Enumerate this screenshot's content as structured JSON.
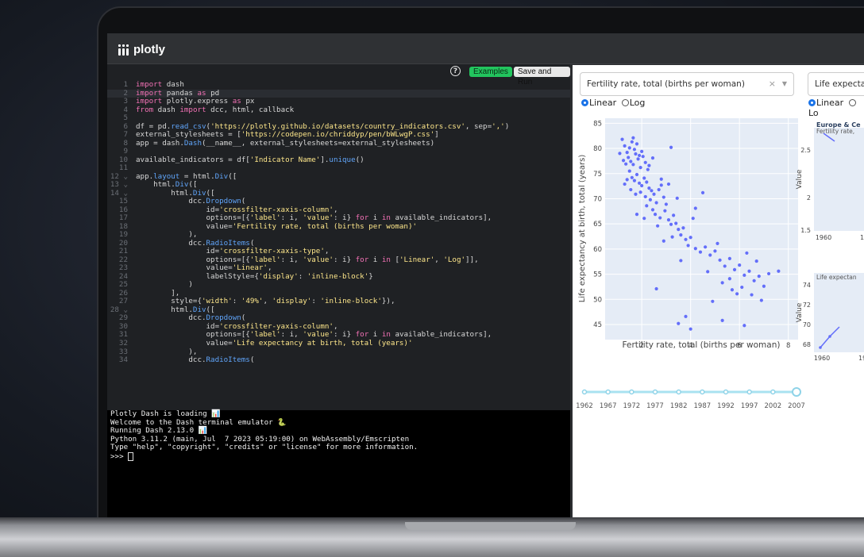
{
  "app": {
    "title": "plotly"
  },
  "toolbar": {
    "help": "?",
    "examples": "Examples",
    "save_run": "Save and Run"
  },
  "code_lines": [
    "import dash",
    "import pandas as pd",
    "import plotly.express as px",
    "from dash import dcc, html, callback",
    "",
    "df = pd.read_csv('https://plotly.github.io/datasets/country_indicators.csv', sep=',')",
    "external_stylesheets = ['https://codepen.io/chriddyp/pen/bWLwgP.css']",
    "app = dash.Dash(__name__, external_stylesheets=external_stylesheets)",
    "",
    "available_indicators = df['Indicator Name'].unique()",
    "",
    "app.layout = html.Div([",
    "    html.Div([",
    "        html.Div([",
    "            dcc.Dropdown(",
    "                id='crossfilter-xaxis-column',",
    "                options=[{'label': i, 'value': i} for i in available_indicators],",
    "                value='Fertility rate, total (births per woman)'",
    "            ),",
    "            dcc.RadioItems(",
    "                id='crossfilter-xaxis-type',",
    "                options=[{'label': i, 'value': i} for i in ['Linear', 'Log']],",
    "                value='Linear',",
    "                labelStyle={'display': 'inline-block'}",
    "            )",
    "        ],",
    "        style={'width': '49%', 'display': 'inline-block'}),",
    "        html.Div([",
    "            dcc.Dropdown(",
    "                id='crossfilter-yaxis-column',",
    "                options=[{'label': i, 'value': i} for i in available_indicators],",
    "                value='Life expectancy at birth, total (years)'",
    "            ),",
    "            dcc.RadioItems("
  ],
  "code_line_count": 34,
  "terminal_lines": [
    "Plotly Dash is loading 📊",
    "Welcome to the Dash terminal emulator 🐍",
    "Running Dash 2.13.0 📊",
    "Python 3.11.2 (main, Jul  7 2023 05:19:00) on WebAssembly/Emscripten",
    "Type \"help\", \"copyright\", \"credits\" or \"license\" for more information.",
    ">>> "
  ],
  "dash_app": {
    "x_dropdown": {
      "value": "Fertility rate, total (births per woman)",
      "clear": "×",
      "caret": "▼"
    },
    "y_dropdown": {
      "value": "Life expectanc"
    },
    "x_radio": {
      "linear": "Linear",
      "log": "Log",
      "selected": "Linear"
    },
    "y_radio": {
      "linear": "Linear",
      "log": "Lo",
      "selected": "Linear"
    },
    "slider": {
      "marks": [
        "1962",
        "1967",
        "1972",
        "1977",
        "1982",
        "1987",
        "1992",
        "1997",
        "2002",
        "2007"
      ],
      "selected": "2007"
    },
    "side1": {
      "title": "Europe & Ce",
      "subtitle": "Fertility rate,",
      "ylabel": "Value",
      "yticks": [
        "2.5",
        "2",
        "1.5"
      ],
      "xticks": [
        "1960",
        "19"
      ]
    },
    "side2": {
      "subtitle": "Life expectan",
      "ylabel": "Value",
      "yticks": [
        "74",
        "72",
        "70",
        "68"
      ],
      "xticks": [
        "1960",
        "19"
      ]
    }
  },
  "colors": {
    "marker": "#636efa",
    "plot_bg": "#e5ecf6",
    "accent": "#1a73e8",
    "examples_btn": "#22c55e"
  },
  "chart_data": {
    "type": "scatter",
    "xlabel": "Fertility rate, total (births per woman)",
    "ylabel": "Life expectancy at birth, total (years)",
    "xlim": [
      0.5,
      8.4
    ],
    "ylim": [
      42,
      86
    ],
    "xticks": [
      2,
      4,
      6,
      8
    ],
    "yticks": [
      45,
      50,
      55,
      60,
      65,
      70,
      75,
      80,
      85
    ],
    "grid": true,
    "series": [
      {
        "points": [
          [
            1.3,
            80.5
          ],
          [
            1.4,
            79.2
          ],
          [
            1.5,
            80.1
          ],
          [
            1.6,
            81.3
          ],
          [
            1.7,
            79.8
          ],
          [
            1.8,
            80.9
          ],
          [
            1.9,
            78.6
          ],
          [
            2.0,
            79.4
          ],
          [
            1.2,
            81.8
          ],
          [
            1.1,
            79.0
          ],
          [
            1.45,
            78.2
          ],
          [
            1.55,
            77.4
          ],
          [
            1.65,
            76.8
          ],
          [
            1.75,
            78.9
          ],
          [
            1.85,
            77.9
          ],
          [
            1.95,
            76.2
          ],
          [
            2.05,
            78.4
          ],
          [
            2.15,
            77.2
          ],
          [
            2.25,
            75.8
          ],
          [
            1.35,
            76.9
          ],
          [
            1.5,
            75.5
          ],
          [
            1.6,
            74.2
          ],
          [
            1.7,
            73.6
          ],
          [
            1.8,
            74.8
          ],
          [
            1.9,
            73.1
          ],
          [
            2.0,
            72.6
          ],
          [
            2.1,
            74.1
          ],
          [
            2.2,
            73.3
          ],
          [
            2.3,
            72.1
          ],
          [
            2.4,
            71.6
          ],
          [
            1.4,
            73.8
          ],
          [
            1.3,
            72.9
          ],
          [
            1.55,
            71.8
          ],
          [
            1.75,
            70.9
          ],
          [
            1.95,
            71.3
          ],
          [
            2.15,
            70.4
          ],
          [
            2.35,
            69.8
          ],
          [
            2.5,
            70.9
          ],
          [
            2.6,
            69.2
          ],
          [
            2.7,
            71.8
          ],
          [
            2.8,
            72.7
          ],
          [
            2.9,
            70.3
          ],
          [
            3.0,
            68.9
          ],
          [
            2.45,
            67.8
          ],
          [
            2.55,
            66.9
          ],
          [
            2.75,
            66.2
          ],
          [
            2.95,
            67.6
          ],
          [
            3.1,
            65.8
          ],
          [
            3.2,
            64.9
          ],
          [
            3.3,
            66.7
          ],
          [
            3.4,
            65.1
          ],
          [
            3.5,
            63.9
          ],
          [
            3.6,
            62.8
          ],
          [
            3.7,
            64.2
          ],
          [
            3.8,
            61.9
          ],
          [
            3.9,
            60.7
          ],
          [
            4.0,
            62.3
          ],
          [
            4.2,
            60.1
          ],
          [
            4.4,
            59.4
          ],
          [
            4.6,
            60.4
          ],
          [
            4.8,
            58.8
          ],
          [
            5.0,
            59.6
          ],
          [
            5.2,
            57.8
          ],
          [
            5.4,
            56.6
          ],
          [
            5.6,
            58.1
          ],
          [
            5.8,
            55.9
          ],
          [
            6.0,
            56.8
          ],
          [
            6.2,
            54.8
          ],
          [
            6.4,
            55.6
          ],
          [
            6.6,
            53.7
          ],
          [
            6.8,
            54.6
          ],
          [
            7.0,
            52.6
          ],
          [
            7.2,
            55.1
          ],
          [
            5.3,
            53.3
          ],
          [
            5.7,
            51.9
          ],
          [
            6.1,
            52.4
          ],
          [
            6.5,
            50.9
          ],
          [
            6.9,
            49.8
          ],
          [
            4.9,
            49.6
          ],
          [
            2.6,
            52.1
          ],
          [
            3.8,
            46.6
          ],
          [
            4.0,
            44.1
          ],
          [
            3.5,
            45.2
          ],
          [
            5.3,
            45.8
          ],
          [
            6.2,
            44.8
          ],
          [
            5.9,
            51.1
          ],
          [
            4.5,
            71.2
          ],
          [
            3.2,
            80.2
          ],
          [
            2.8,
            73.9
          ],
          [
            2.2,
            68.6
          ],
          [
            1.8,
            66.9
          ],
          [
            2.3,
            76.6
          ],
          [
            4.2,
            68.1
          ],
          [
            6.3,
            59.2
          ],
          [
            7.6,
            55.6
          ],
          [
            3.6,
            57.7
          ],
          [
            4.7,
            55.5
          ],
          [
            2.9,
            61.6
          ],
          [
            5.6,
            54.1
          ],
          [
            3.1,
            72.9
          ],
          [
            1.25,
            77.6
          ],
          [
            1.65,
            82.1
          ],
          [
            2.45,
            78.1
          ],
          [
            2.1,
            66.1
          ],
          [
            2.65,
            64.6
          ],
          [
            3.25,
            62.4
          ],
          [
            3.45,
            70.1
          ],
          [
            4.1,
            66.1
          ],
          [
            5.1,
            61.1
          ],
          [
            6.7,
            57.6
          ]
        ]
      }
    ]
  }
}
